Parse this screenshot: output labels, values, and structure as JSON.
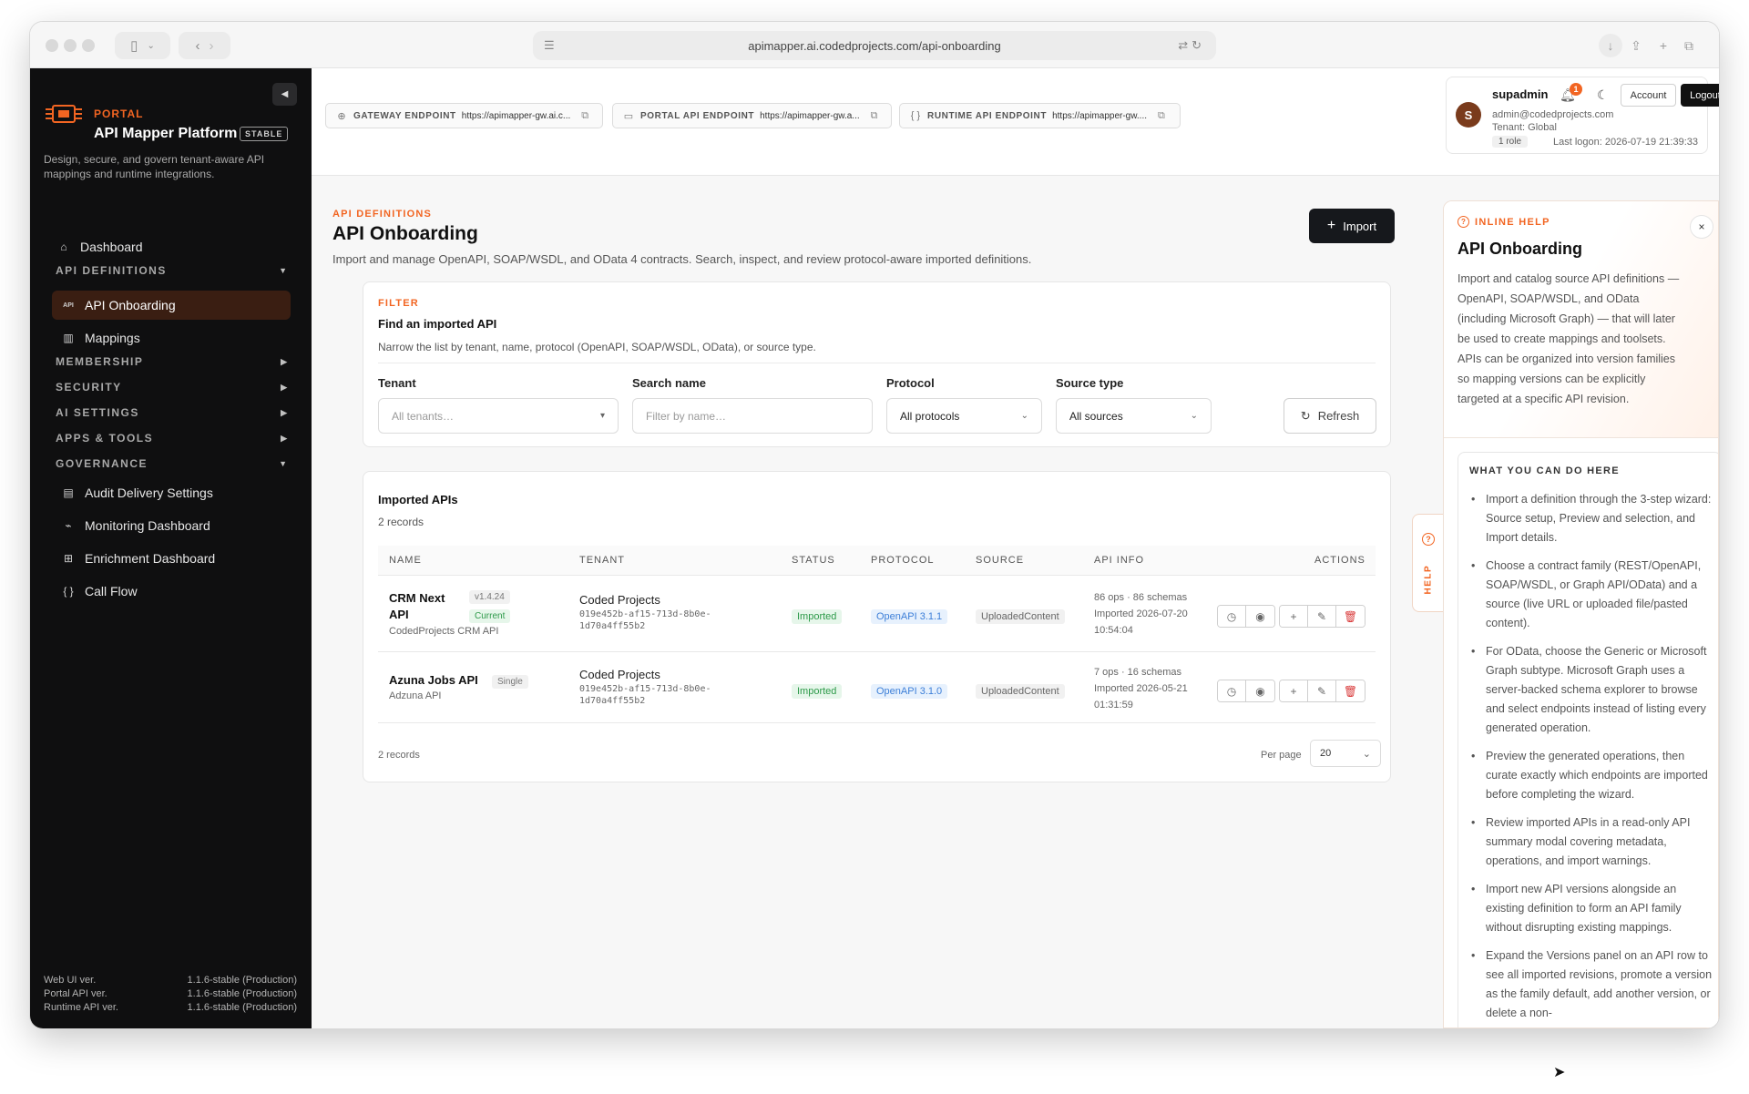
{
  "browser": {
    "url": "apimapper.ai.codedprojects.com/api-onboarding"
  },
  "sidebar": {
    "portal_label": "PORTAL",
    "app_name": "API Mapper Platform",
    "badge": "STABLE",
    "description": "Design, secure, and govern tenant-aware API mappings and runtime integrations.",
    "dashboard": "Dashboard",
    "sections": {
      "api_definitions": "API DEFINITIONS",
      "membership": "MEMBERSHIP",
      "security": "SECURITY",
      "ai_settings": "AI SETTINGS",
      "apps_tools": "APPS & TOOLS",
      "governance": "GOVERNANCE"
    },
    "api_onboarding": "API Onboarding",
    "api_onboarding_icon_text": "API",
    "mappings": "Mappings",
    "governance_items": [
      "Audit Delivery Settings",
      "Monitoring Dashboard",
      "Enrichment Dashboard",
      "Call Flow"
    ],
    "call_flow_icon_text": "{ }",
    "versions": [
      {
        "label": "Web UI ver.",
        "value": "1.1.6-stable (Production)"
      },
      {
        "label": "Portal API ver.",
        "value": "1.1.6-stable (Production)"
      },
      {
        "label": "Runtime API ver.",
        "value": "1.1.6-stable (Production)"
      }
    ]
  },
  "endpoints": [
    {
      "label": "GATEWAY ENDPOINT",
      "url": "https://apimapper-gw.ai.c..."
    },
    {
      "label": "PORTAL API ENDPOINT",
      "url": "https://apimapper-gw.a..."
    },
    {
      "label": "RUNTIME API ENDPOINT",
      "url": "https://apimapper-gw...."
    }
  ],
  "runtime_endpoint_icon_text": "{ }",
  "user": {
    "avatar_letter": "S",
    "name": "supadmin",
    "notifications": "1",
    "account_label": "Account",
    "logout_label": "Logout",
    "email": "admin@codedprojects.com",
    "tenant": "Tenant: Global",
    "role": "1 role",
    "last_logon": "Last logon: 2026-07-19 21:39:33"
  },
  "page": {
    "kicker": "API DEFINITIONS",
    "title": "API Onboarding",
    "description": "Import and manage OpenAPI, SOAP/WSDL, and OData 4 contracts. Search, inspect, and review protocol-aware imported definitions.",
    "import_label": "Import"
  },
  "filter": {
    "kicker": "FILTER",
    "title": "Find an imported API",
    "subtitle": "Narrow the list by tenant, name, protocol (OpenAPI, SOAP/WSDL, OData), or source type.",
    "tenant_label": "Tenant",
    "tenant_placeholder": "All tenants…",
    "search_label": "Search name",
    "search_placeholder": "Filter by name…",
    "protocol_label": "Protocol",
    "protocol_value": "All protocols",
    "source_label": "Source type",
    "source_value": "All sources",
    "refresh_label": "Refresh"
  },
  "table": {
    "title": "Imported APIs",
    "count": "2 records",
    "columns": [
      "NAME",
      "TENANT",
      "STATUS",
      "PROTOCOL",
      "SOURCE",
      "API INFO",
      "ACTIONS"
    ],
    "rows": [
      {
        "name_line1": "CRM Next",
        "name_line2": "API",
        "version": "v1.4.24",
        "tag": "Current",
        "subtitle": "CodedProjects CRM API",
        "tenant": "Coded Projects",
        "tenant_id_1": "019e452b-af15-713d-8b0e-",
        "tenant_id_2": "1d70a4ff55b2",
        "status": "Imported",
        "protocol": "OpenAPI 3.1.1",
        "source": "UploadedContent",
        "info_1": "86 ops · 86 schemas",
        "info_2": "Imported 2026-07-20",
        "info_3": "10:54:04"
      },
      {
        "name_line1": "Azuna Jobs API",
        "tag": "Single",
        "subtitle": "Adzuna API",
        "tenant": "Coded Projects",
        "tenant_id_1": "019e452b-af15-713d-8b0e-",
        "tenant_id_2": "1d70a4ff55b2",
        "status": "Imported",
        "protocol": "OpenAPI 3.1.0",
        "source": "UploadedContent",
        "info_1": "7 ops · 16 schemas",
        "info_2": "Imported 2026-05-21",
        "info_3": "01:31:59"
      }
    ],
    "footer_count": "2 records",
    "per_page_label": "Per page",
    "per_page_value": "20"
  },
  "help": {
    "tab_label": "HELP",
    "kicker": "INLINE HELP",
    "title": "API Onboarding",
    "intro": "Import and catalog source API definitions — OpenAPI, SOAP/WSDL, and OData (including Microsoft Graph) — that will later be used to create mappings and toolsets. APIs can be organized into version families so mapping versions can be explicitly targeted at a specific API revision.",
    "box_title": "WHAT YOU CAN DO HERE",
    "items": [
      "Import a definition through the 3-step wizard: Source setup, Preview and selection, and Import details.",
      "Choose a contract family (REST/OpenAPI, SOAP/WSDL, or Graph API/OData) and a source (live URL or uploaded file/pasted content).",
      "For OData, choose the Generic or Microsoft Graph subtype. Microsoft Graph uses a server-backed schema explorer to browse and select endpoints instead of listing every generated operation.",
      "Preview the generated operations, then curate exactly which endpoints are imported before completing the wizard.",
      "Review imported APIs in a read-only API summary modal covering metadata, operations, and import warnings.",
      "Import new API versions alongside an existing definition to form an API family without disrupting existing mappings.",
      "Expand the Versions panel on an API row to see all imported revisions, promote a version as the family default, add another version, or delete a non-"
    ]
  },
  "colors": {
    "accent": "#f26522",
    "sidebar_bg": "#0f0f10",
    "active_nav_bg": "#3a1e12",
    "success": "#2e9a4a",
    "info": "#3d7fd8",
    "danger": "#d93a3a"
  }
}
